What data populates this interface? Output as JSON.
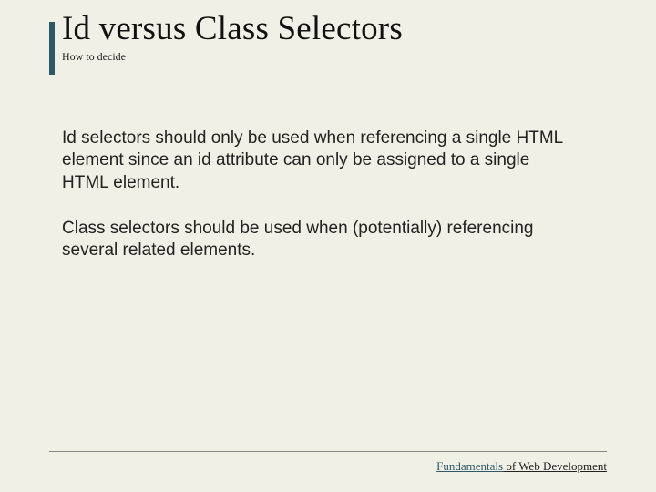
{
  "header": {
    "title": "Id versus Class Selectors",
    "subtitle": "How to decide"
  },
  "body": {
    "p1": "Id selectors should only be used when referencing a single HTML element since an id attribute can only be assigned to a single HTML element.",
    "p2": "Class selectors should be used when (potentially) referencing several related elements."
  },
  "footer": {
    "brand": "Fundamentals",
    "rest": " of Web Development"
  }
}
